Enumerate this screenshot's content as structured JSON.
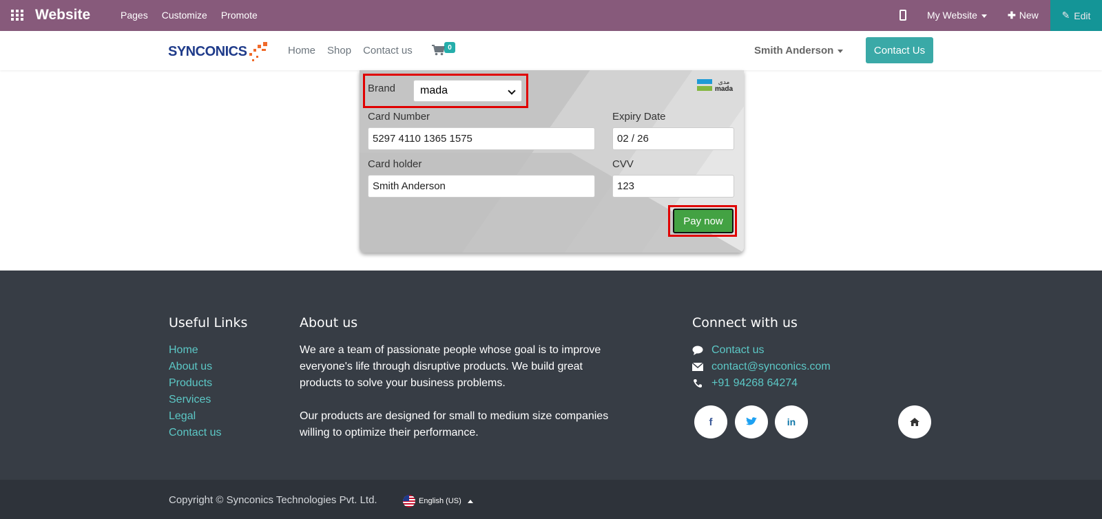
{
  "admin_bar": {
    "title": "Website",
    "menu": [
      "Pages",
      "Customize",
      "Promote"
    ],
    "website_selector": "My Website",
    "new_label": "New",
    "edit_label": "Edit"
  },
  "site_header": {
    "logo_text": "SYNCONICS",
    "nav": [
      "Home",
      "Shop",
      "Contact us"
    ],
    "cart_count": "0",
    "user_name": "Smith Anderson",
    "contact_button": "Contact Us"
  },
  "payment_form": {
    "brand_label": "Brand",
    "brand_value": "mada",
    "card_number_label": "Card Number",
    "card_number_value": "5297 4110 1365 1575",
    "expiry_label": "Expiry Date",
    "expiry_value": "02 / 26",
    "holder_label": "Card holder",
    "holder_value": "Smith Anderson",
    "cvv_label": "CVV",
    "cvv_value": "123",
    "pay_button": "Pay now",
    "logo_arabic": "مدى",
    "logo_latin": "mada"
  },
  "footer": {
    "useful_links_title": "Useful Links",
    "useful_links": [
      "Home",
      "About us",
      "Products",
      "Services",
      "Legal",
      "Contact us"
    ],
    "about_title": "About us",
    "about_p1": "We are a team of passionate people whose goal is to improve everyone's life through disruptive products. We build great products to solve your business problems.",
    "about_p2": "Our products are designed for small to medium size companies willing to optimize their performance.",
    "connect_title": "Connect with us",
    "connect_contact": "Contact us",
    "connect_email": "contact@synconics.com",
    "connect_phone": "+91 94268 64274",
    "social": {
      "facebook": "f",
      "linkedin": "in"
    },
    "copyright": "Copyright © Synconics Technologies Pvt. Ltd.",
    "language": "English (US)"
  },
  "colors": {
    "admin_bar": "#875a7b",
    "accent": "#00a09d",
    "footer": "#373d45",
    "link": "#5cc8c6",
    "pay_button": "#43a243",
    "highlight": "#e00000"
  }
}
